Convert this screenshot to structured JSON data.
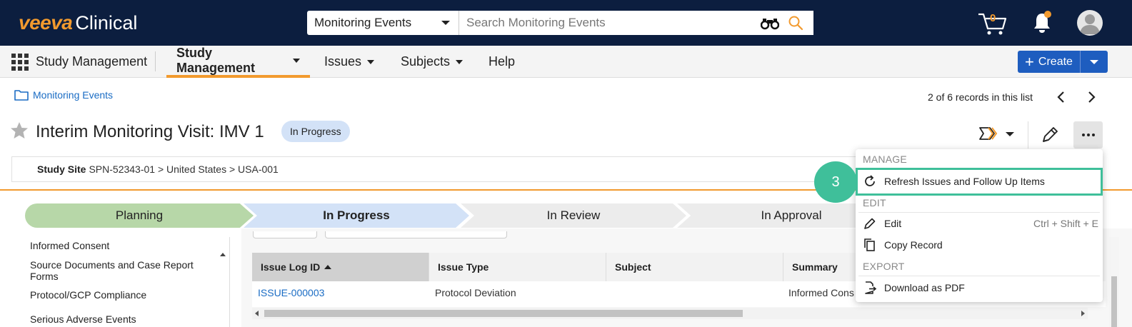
{
  "header": {
    "logo_brand": "veeva",
    "logo_product": "Clinical",
    "search_scope": "Monitoring Events",
    "search_placeholder": "Search Monitoring Events",
    "cart_count": "0"
  },
  "nav": {
    "app_name": "Study Management",
    "tabs": [
      {
        "label": "Study Management"
      },
      {
        "label": "Issues"
      },
      {
        "label": "Subjects"
      },
      {
        "label": "Help"
      }
    ],
    "create_label": "Create"
  },
  "breadcrumb": {
    "label": "Monitoring Events"
  },
  "record_nav": {
    "count_text": "2 of 6 records in this list"
  },
  "record": {
    "title": "Interim Monitoring Visit: IMV 1",
    "status": "In Progress",
    "site_label": "Study Site",
    "site_value": "SPN-52343-01 > United States > USA-001"
  },
  "lifecycle": {
    "stages": [
      "Planning",
      "In Progress",
      "In Review",
      "In Approval"
    ]
  },
  "left_panel": {
    "items": [
      "Informed Consent",
      "Source Documents and Case Report Forms",
      "Protocol/GCP Compliance",
      "Serious Adverse Events"
    ]
  },
  "table": {
    "columns": [
      "Issue Log ID",
      "Issue Type",
      "Subject",
      "Summary"
    ],
    "rows": [
      {
        "id": "ISSUE-000003",
        "type": "Protocol Deviation",
        "subject": "",
        "summary": "Informed Cons"
      }
    ]
  },
  "menu": {
    "manage_label": "MANAGE",
    "refresh_label": "Refresh Issues and Follow Up Items",
    "edit_section": "EDIT",
    "edit_label": "Edit",
    "edit_shortcut": "Ctrl + Shift + E",
    "copy_label": "Copy Record",
    "export_section": "EXPORT",
    "download_label": "Download as PDF"
  },
  "annotation": {
    "step": "3"
  },
  "colors": {
    "topbar": "#0c1e3f",
    "brand_orange": "#f29a2e",
    "primary_blue": "#1e5dbf",
    "planning_green": "#b7d7a8",
    "progress_blue": "#d3e2f7",
    "highlight_teal": "#3fbf9a"
  }
}
